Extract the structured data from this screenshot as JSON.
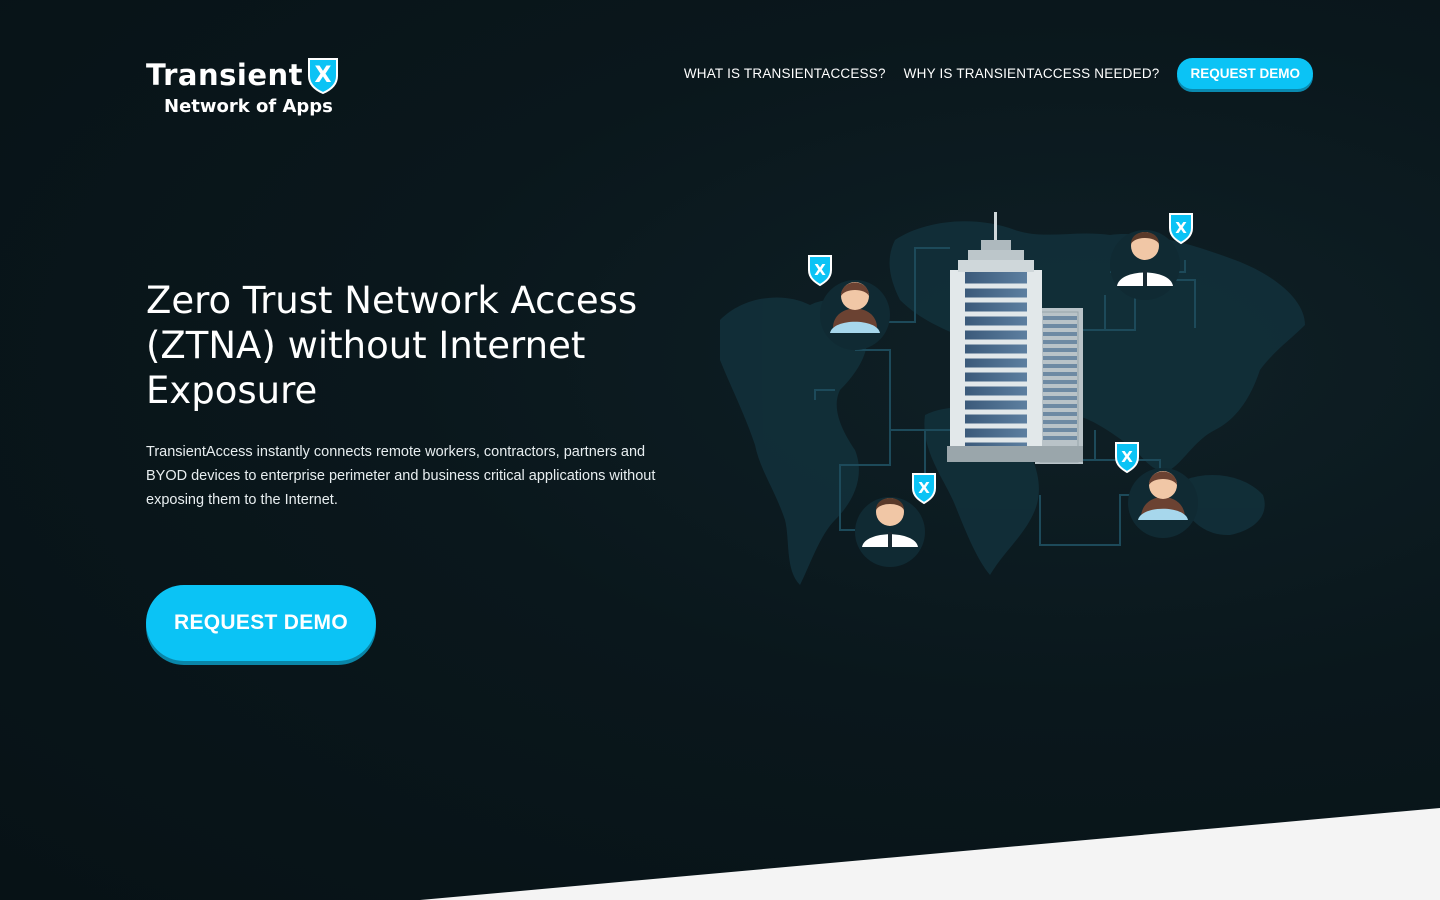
{
  "brand": {
    "name": "Transient",
    "mark": "X",
    "tagline": "Network of Apps"
  },
  "nav": {
    "links": [
      "WHAT IS TRANSIENTACCESS?",
      "WHY IS TRANSIENTACCESS NEEDED?"
    ],
    "cta": "REQUEST DEMO"
  },
  "hero": {
    "title": "Zero Trust Network Access (ZTNA) without Internet Exposure",
    "description": "TransientAccess instantly connects remote workers, contractors, partners and BYOD devices to enterprise perimeter and business critical applications without exposing them to the Internet.",
    "cta": "REQUEST DEMO"
  },
  "colors": {
    "accent": "#0bc3f5",
    "background": "#0a171c",
    "footer_band": "#f4f4f4"
  },
  "illustration": {
    "badge_mark": "X",
    "icons": [
      "world-map",
      "office-building",
      "user-avatar",
      "shield-badge"
    ]
  }
}
